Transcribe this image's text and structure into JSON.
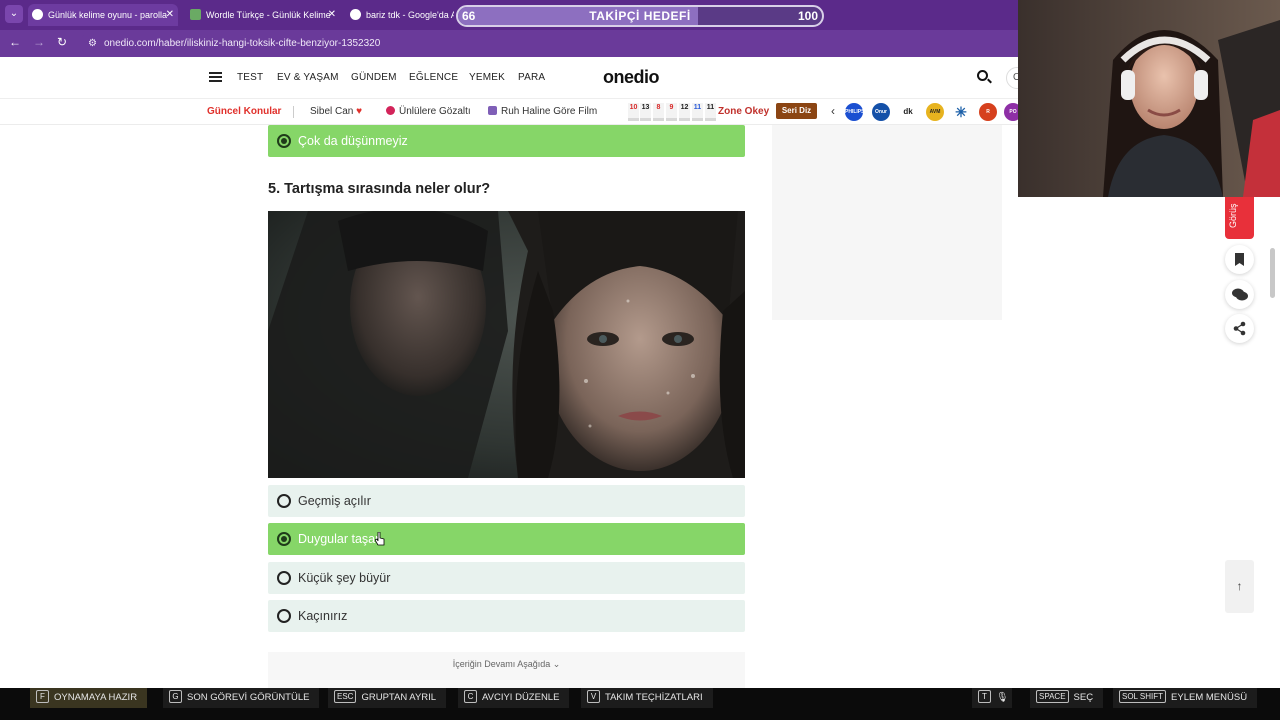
{
  "browser": {
    "tabs": [
      {
        "title": "Günlük kelime oyunu - parolla"
      },
      {
        "title": "Wordle Türkçe - Günlük Kelime"
      },
      {
        "title": "bariz tdk - Google'da Ara"
      }
    ],
    "url": "onedio.com/haber/iliskiniz-hangi-toksik-cifte-benziyor-1352320"
  },
  "stream_goal": {
    "label": "TAKİPÇİ HEDEFİ",
    "current": "66",
    "target": "100",
    "progress": 0.66
  },
  "site": {
    "logo": "onedio",
    "nav": [
      "TEST",
      "EV & YAŞAM",
      "GÜNDEM",
      "EĞLENCE",
      "YEMEK",
      "PARA"
    ],
    "profile_initial": "O",
    "topics": {
      "label": "Güncel Konular",
      "items": [
        "Sibel Can",
        "Ünlülere Gözaltı",
        "Ruh Haline Göre Film"
      ],
      "numbers": [
        "10",
        "13",
        "8",
        "9",
        "12",
        "11",
        "11"
      ],
      "zone": "Zone Okey",
      "seri": "Seri Diz"
    },
    "brands": [
      "PHILIPS",
      "Onur",
      "dk",
      "AVM",
      "✳",
      "R",
      "PO"
    ]
  },
  "colors": {
    "selected": "#86d668",
    "option": "#e8f2ee",
    "accent_red": "#e0302b"
  },
  "quiz": {
    "prev_selected": "Çok da düşünmeyiz",
    "question": "5. Tartışma sırasında neler olur?",
    "options": [
      {
        "label": "Geçmiş açılır",
        "selected": false
      },
      {
        "label": "Duygular taşar",
        "selected": true
      },
      {
        "label": "Küçük şey büyür",
        "selected": false
      },
      {
        "label": "Kaçınırız",
        "selected": false
      }
    ],
    "more_label": "İçeriğin Devamı Aşağıda"
  },
  "sidebar": {
    "gorus_label": "Görüş"
  },
  "game_bar": [
    {
      "key": "F",
      "label": "OYNAMAYA HAZIR"
    },
    {
      "key": "G",
      "label": "SON GÖREVİ GÖRÜNTÜLE"
    },
    {
      "key": "ESC",
      "label": "GRUPTAN AYRIL"
    },
    {
      "key": "C",
      "label": "AVCIYI DÜZENLE"
    },
    {
      "key": "V",
      "label": "TAKIM TEÇHİZATLARI"
    },
    {
      "key": "T",
      "label": ""
    },
    {
      "key": "SPACE",
      "label": "SEÇ"
    },
    {
      "key": "SOL SHIFT",
      "label": "EYLEM MENÜSÜ"
    }
  ]
}
